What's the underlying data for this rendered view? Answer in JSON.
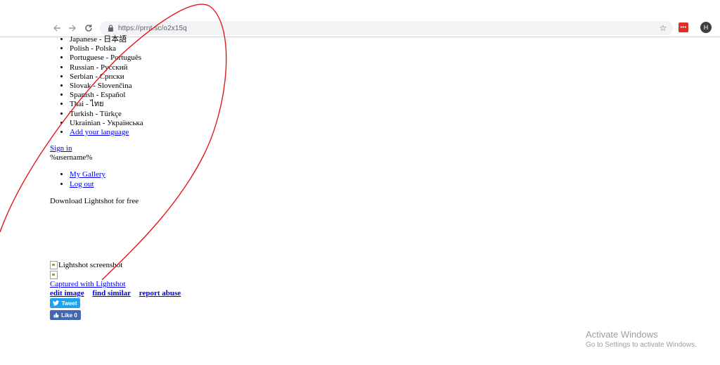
{
  "browser": {
    "url": "https://prnt.sc/o2x15q",
    "profile_initial": "H",
    "extension_label": "•••"
  },
  "languages": [
    "Japanese - 日本語",
    "Polish - Polska",
    "Portuguese - Português",
    "Russian - Русский",
    "Serbian - Српски",
    "Slovak - Slovenčina",
    "Spanish - Español",
    "Thai - ไทย",
    "Turkish - Türkçe",
    "Ukrainian - Українська"
  ],
  "add_language": "Add your language",
  "sign_in": "Sign in",
  "username": "%username%",
  "user_menu": {
    "gallery": "My Gallery",
    "logout": "Log out"
  },
  "download_text": "Download Lightshot for free",
  "screenshot_alt": "Lightshot screenshot",
  "captured": "Captured with Lightshot",
  "actions": {
    "edit": "edit image",
    "similar": "find similar",
    "abuse": "report abuse"
  },
  "social": {
    "tweet": "Tweet",
    "like": "Like 0"
  },
  "watermark": {
    "title": "Activate Windows",
    "subtitle": "Go to Settings to activate Windows."
  },
  "colors": {
    "link": "#0000ee",
    "tweet": "#1da1f2",
    "facebook": "#4267b2",
    "scribble": "#e0191d"
  }
}
